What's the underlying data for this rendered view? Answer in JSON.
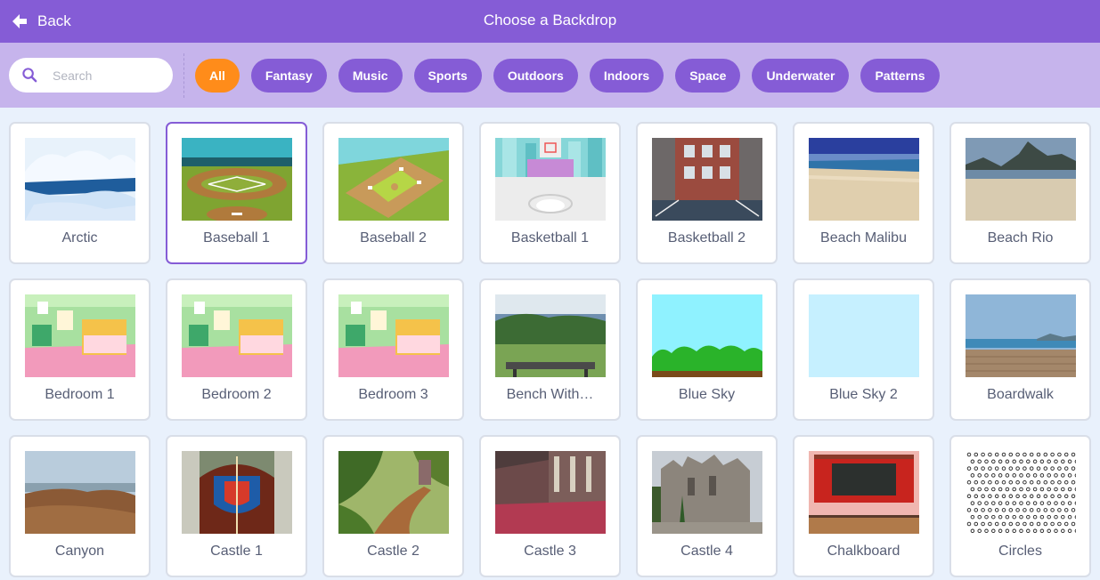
{
  "header": {
    "back_label": "Back",
    "title": "Choose a Backdrop"
  },
  "search": {
    "placeholder": "Search"
  },
  "categories": [
    "All",
    "Fantasy",
    "Music",
    "Sports",
    "Outdoors",
    "Indoors",
    "Space",
    "Underwater",
    "Patterns"
  ],
  "active_category": "All",
  "backdrops": [
    {
      "label": "Arctic",
      "thumb": "arctic-thumbnail"
    },
    {
      "label": "Baseball 1",
      "thumb": "baseball-field-thumbnail",
      "selected": true
    },
    {
      "label": "Baseball 2",
      "thumb": "baseball-diamond-thumbnail"
    },
    {
      "label": "Basketball 1",
      "thumb": "basketball-court-thumbnail"
    },
    {
      "label": "Basketball 2",
      "thumb": "basketball-outdoor-thumbnail"
    },
    {
      "label": "Beach Malibu",
      "thumb": "beach-thumbnail"
    },
    {
      "label": "Beach Rio",
      "thumb": "beach-mountain-thumbnail"
    },
    {
      "label": "Bedroom 1",
      "thumb": "bedroom-thumbnail"
    },
    {
      "label": "Bedroom 2",
      "thumb": "bedroom-thumbnail"
    },
    {
      "label": "Bedroom 3",
      "thumb": "bedroom-thumbnail"
    },
    {
      "label": "Bench With…",
      "thumb": "bench-view-thumbnail"
    },
    {
      "label": "Blue Sky",
      "thumb": "blue-sky-hills-thumbnail"
    },
    {
      "label": "Blue Sky 2",
      "thumb": "plain-sky-thumbnail"
    },
    {
      "label": "Boardwalk",
      "thumb": "boardwalk-thumbnail"
    },
    {
      "label": "Canyon",
      "thumb": "canyon-thumbnail"
    },
    {
      "label": "Castle 1",
      "thumb": "castle-gate-thumbnail"
    },
    {
      "label": "Castle 2",
      "thumb": "forest-path-thumbnail"
    },
    {
      "label": "Castle 3",
      "thumb": "castle-hall-thumbnail"
    },
    {
      "label": "Castle 4",
      "thumb": "castle-ruins-thumbnail"
    },
    {
      "label": "Chalkboard",
      "thumb": "chalkboard-thumbnail"
    },
    {
      "label": "Circles",
      "thumb": "circles-pattern-thumbnail"
    }
  ],
  "colors": {
    "header_bg": "#855cd6",
    "filter_bg": "#c6b4ec",
    "chip_bg": "#855cd6",
    "chip_active_bg": "#ff8c1a",
    "page_bg": "#e9f1fc",
    "card_border": "#d9dee8",
    "selected_border": "#855cd6",
    "label_text": "#575e75"
  }
}
